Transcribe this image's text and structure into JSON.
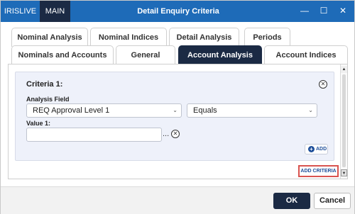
{
  "titlebar": {
    "app_name": "IRISLIVE",
    "environment": "MAIN",
    "title": "Detail Enquiry Criteria",
    "minimize_glyph": "—",
    "maximize_glyph": "☐",
    "close_glyph": "✕"
  },
  "tabs": {
    "row1": [
      "Nominal Analysis",
      "Nominal Indices",
      "Detail Analysis",
      "Periods"
    ],
    "row2": [
      "Nominals and Accounts",
      "General",
      "Account Analysis",
      "Account Indices"
    ],
    "active": "Account Analysis"
  },
  "criteria": {
    "title": "Criteria 1:",
    "analysis_field_label": "Analysis Field",
    "analysis_field_value": "REQ Approval Level 1",
    "operator_value": "Equals",
    "value_label": "Value 1:",
    "value_input": "",
    "ellipsis": "...",
    "add_label": "ADD"
  },
  "add_criteria_label": "ADD CRITERIA",
  "footer": {
    "ok_label": "OK",
    "cancel_label": "Cancel"
  },
  "colors": {
    "titlebar": "#1e6bb8",
    "navy": "#1b2a44",
    "highlight_border": "#d9534f",
    "link_blue": "#1e4f9a"
  }
}
